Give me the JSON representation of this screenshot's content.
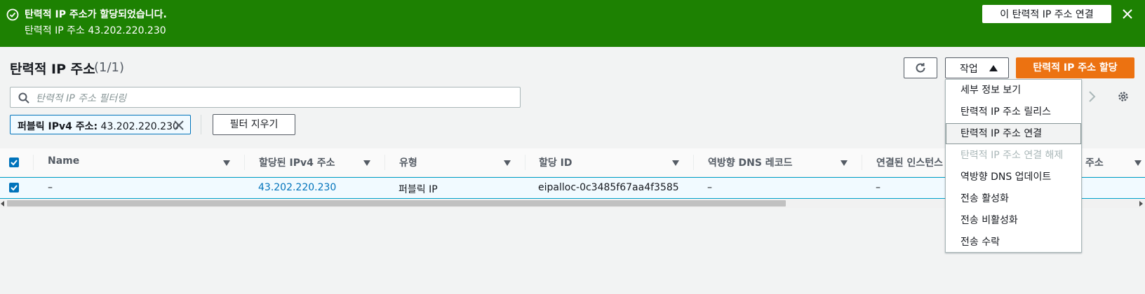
{
  "flash": {
    "title": "탄력적 IP 주소가 할당되었습니다.",
    "detail": "탄력적 IP 주소 43.202.220.230",
    "action_label": "이 탄력적 IP 주소 연결",
    "status_color": "#1d8102"
  },
  "header": {
    "title": "탄력적 IP 주소",
    "count": "(1/1)"
  },
  "toolbar": {
    "actions_label": "작업",
    "allocate_label": "탄력적 IP 주소 할당",
    "accent_color": "#ec7211"
  },
  "filter": {
    "placeholder": "탄력적 IP 주소 필터링",
    "token_key": "퍼블릭 IPv4 주소:",
    "token_value": "43.202.220.230",
    "clear_label": "필터 지우기"
  },
  "table": {
    "columns": [
      "Name",
      "할당된 IPv4 주소",
      "유형",
      "할당 ID",
      "역방향 DNS 레코드",
      "연결된 인스턴스",
      "주소"
    ],
    "rows": [
      {
        "selected": true,
        "name": "–",
        "ipv4": "43.202.220.230",
        "type": "퍼블릭 IP",
        "allocation_id": "eipalloc-0c3485f67aa4f3585",
        "reverse_dns": "–",
        "instance": "–"
      }
    ]
  },
  "actions_menu": {
    "items": [
      {
        "label": "세부 정보 보기",
        "state": "enabled"
      },
      {
        "label": "탄력적 IP 주소 릴리스",
        "state": "enabled"
      },
      {
        "label": "탄력적 IP 주소 연결",
        "state": "hover"
      },
      {
        "label": "탄력적 IP 주소 연결 해제",
        "state": "disabled"
      },
      {
        "label": "역방향 DNS 업데이트",
        "state": "enabled"
      },
      {
        "label": "전송 활성화",
        "state": "enabled"
      },
      {
        "label": "전송 비활성화",
        "state": "enabled"
      },
      {
        "label": "전송 수락",
        "state": "enabled"
      }
    ]
  },
  "icons": {
    "flash": [
      "check-circle-icon",
      "close-icon"
    ],
    "toolbar": [
      "refresh-icon",
      "caret-up-icon"
    ],
    "filter": [
      "search-icon",
      "dismiss-token-icon"
    ],
    "pagination": [
      "chevron-right-icon",
      "gear-icon"
    ]
  }
}
